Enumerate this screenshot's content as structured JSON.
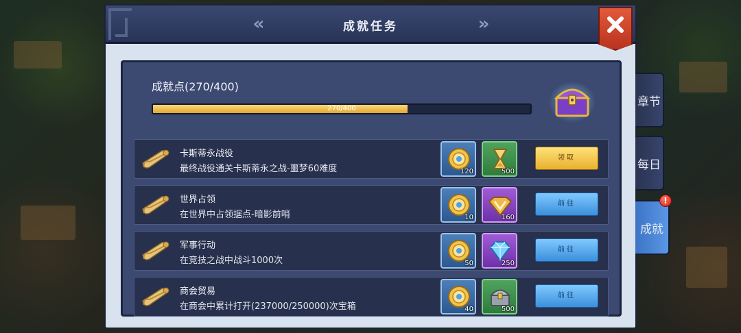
{
  "window": {
    "title": "成就任务",
    "prev_label": "«",
    "next_label": "»",
    "close_label": "close"
  },
  "progress": {
    "label": "成就点(270/400)",
    "bar_text": "270/400",
    "current": 270,
    "max": 400,
    "fraction": 0.675
  },
  "tasks": [
    {
      "icon": "scroll-icon",
      "title": "卡斯蒂永战役",
      "desc": "最终战役通关卡斯蒂永之战-噩梦60难度",
      "rewards": [
        {
          "icon": "coin-icon",
          "qty": "120"
        },
        {
          "icon": "hourglass-icon",
          "qty": "500"
        }
      ],
      "button": "领取",
      "button_type": "claim"
    },
    {
      "icon": "scroll-icon",
      "title": "世界占领",
      "desc": "在世界中占领据点-暗影前哨",
      "rewards": [
        {
          "icon": "coin-icon",
          "qty": "10"
        },
        {
          "icon": "v-badge-icon",
          "qty": "160"
        }
      ],
      "button": "前往",
      "button_type": "go"
    },
    {
      "icon": "scroll-icon",
      "title": "军事行动",
      "desc": "在竞技之战中战斗1000次",
      "rewards": [
        {
          "icon": "coin-icon",
          "qty": "50"
        },
        {
          "icon": "diamond-icon",
          "qty": "250"
        }
      ],
      "button": "前往",
      "button_type": "go"
    },
    {
      "icon": "scroll-icon",
      "title": "商会贸易",
      "desc": "在商会中累计打开(237000/250000)次宝箱",
      "rewards": [
        {
          "icon": "coin-icon",
          "qty": "40"
        },
        {
          "icon": "chest-icon",
          "qty": "500"
        }
      ],
      "button": "前往",
      "button_type": "go"
    }
  ],
  "side_tabs": [
    {
      "label": "章节",
      "active": false
    },
    {
      "label": "每日",
      "active": false
    },
    {
      "label": "成就",
      "active": true,
      "badge": "!"
    }
  ],
  "colors": {
    "progress_fill": "#e9b13b",
    "claim_button": "#f3c64a",
    "go_button": "#5aa9ee",
    "close_button": "#d2452a"
  }
}
